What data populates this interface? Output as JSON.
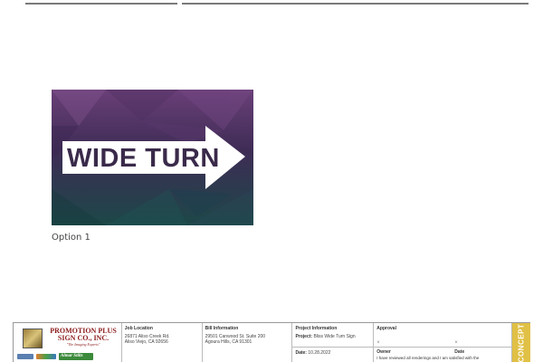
{
  "sign": {
    "text": "WIDE TURN",
    "colors": {
      "bg_top": "#5e3a6e",
      "bg_bottom": "#1f4a4a",
      "panel": "#ffffff",
      "text": "#3a2a4a"
    }
  },
  "caption": "Option 1",
  "title_block": {
    "company": {
      "name_line1": "PROMOTION PLUS",
      "name_line2": "SIGN CO., INC.",
      "tagline": "\"The Imaging Experts\"",
      "badge_text": "Almar Stilts"
    },
    "job_location": {
      "header": "Job Location",
      "line1": "26871 Aliso Creek Rd.",
      "line2": "Aliso Viejo, CA 92656"
    },
    "bill_information": {
      "header": "Bill Information",
      "line1": "29501 Canwood St. Suite 200",
      "line2": "Agoura Hills, CA 91301"
    },
    "project_information": {
      "header": "Project Information",
      "project_label": "Project:",
      "project_value": "Bliss Wide Turn Sign",
      "date_label": "Date:",
      "date_value": "10.28.2022"
    },
    "approval": {
      "header": "Approval",
      "x_mark": "×",
      "owner_label": "Owner",
      "date_label": "Date",
      "note": "I have reviewed all renderings and I am satisfied with the"
    },
    "concept_label": "CONCEPT"
  }
}
